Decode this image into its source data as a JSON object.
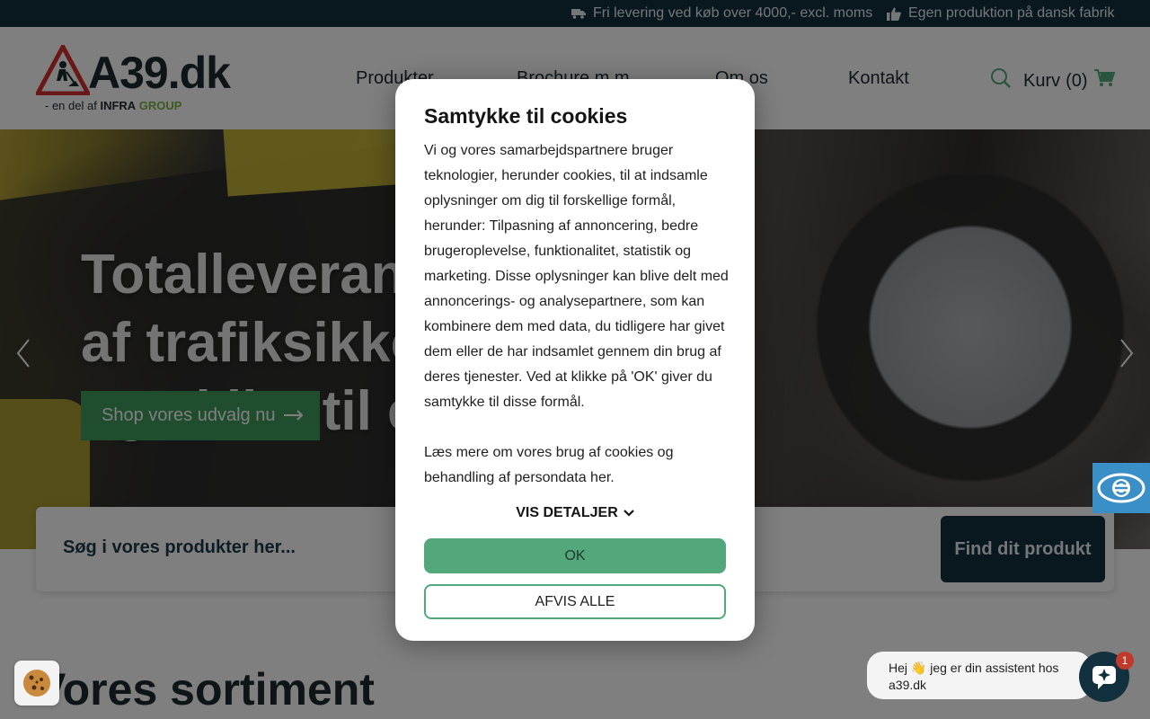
{
  "topbar": {
    "usp_delivery": "Fri levering ved køb over 4000,- excl. moms",
    "usp_production": "Egen produktion på dansk fabrik",
    "delivery_icon": "truck-icon",
    "production_icon": "thumbs-up-icon"
  },
  "header": {
    "logo_text": "A39.dk",
    "logo_sub_prefix": "- en del af",
    "logo_sub_infra": "INFRA",
    "logo_sub_group": "GROUP",
    "nav": [
      "Produkter",
      "Brochure m.m.",
      "Om os",
      "Kontakt"
    ],
    "cart_label": "Kurv",
    "cart_count": "(0)",
    "search_icon": "search-icon",
    "cart_icon": "cart-icon"
  },
  "hero": {
    "title": "Totalleverandør af trafiksikkerhed og skilte til et",
    "cta_label": "Shop vores udvalg nu"
  },
  "search": {
    "label": "Søg i vores produkter her...",
    "button_label": "Find dit produkt"
  },
  "section": {
    "title": "Vores sortiment"
  },
  "cookie_modal": {
    "title": "Samtykke til cookies",
    "body": "Vi og vores samarbejdspartnere bruger teknologier, herunder cookies, til at indsamle oplysninger om dig til forskellige formål, herunder: Tilpasning af annoncering, bedre brugeroplevelse, funktionalitet, statistik og marketing. Disse oplysninger kan blive delt med annoncerings- og analysepartnere, som kan kombinere dem med data, du tidligere har givet dem eller de har indsamlet gennem din brug af deres tjenester. Ved at klikke på 'OK' giver du samtykke til disse formål.",
    "link_text": "Læs mere om vores brug af cookies og behandling af persondata her.",
    "details_label": "VIS DETALJER",
    "ok_label": "OK",
    "reject_label": "AFVIS ALLE"
  },
  "chat": {
    "greeting": "Hej 👋 jeg er din assistent hos a39.dk",
    "badge_count": "1"
  },
  "colors": {
    "topbar": "#12303d",
    "accent_green": "#52a87a",
    "cta_green": "#3e9a5d",
    "a11y_blue": "#3a8fc6"
  }
}
